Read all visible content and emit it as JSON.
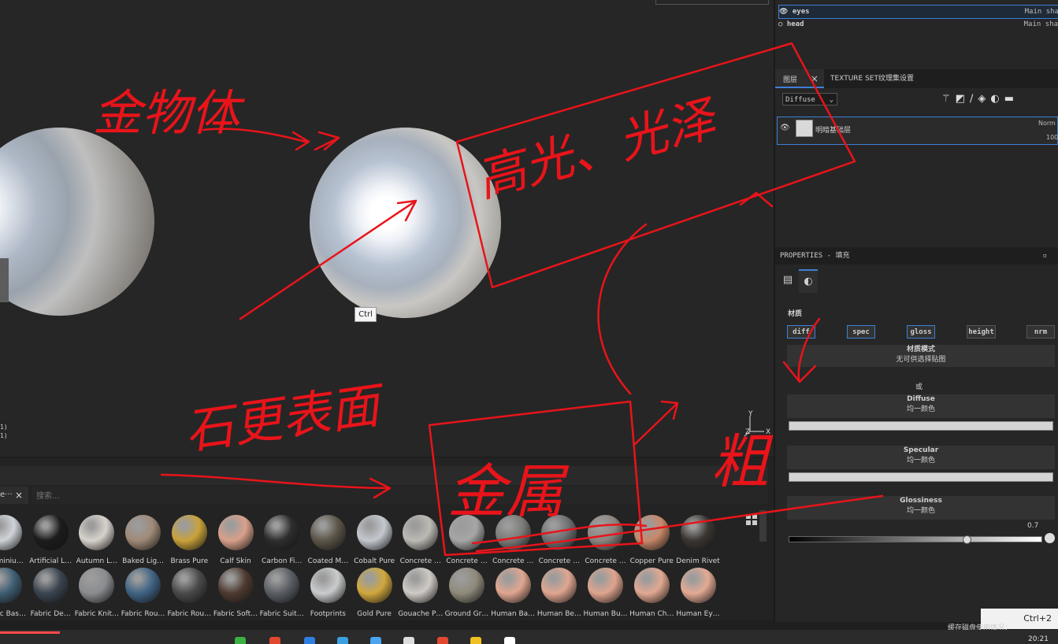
{
  "viewport": {
    "tooltip": "Ctrl",
    "coords_1": "1)",
    "coords_2": "1)",
    "axis_y": "Y",
    "axis_x": "X",
    "axis_z": "Z"
  },
  "shelf": {
    "tab_label": "e···",
    "close": "×",
    "search_placeholder": "搜索...",
    "materials": [
      {
        "label": "Aluminiu…",
        "color": "#cfd3d8"
      },
      {
        "label": "Artificial L…",
        "color": "#1c1c1c"
      },
      {
        "label": "Autumn L…",
        "color": "#d8d2cc"
      },
      {
        "label": "Baked Lig…",
        "color": "#a08a78"
      },
      {
        "label": "Brass Pure",
        "color": "#c9a23a"
      },
      {
        "label": "Calf Skin",
        "color": "#d9a08a"
      },
      {
        "label": "Carbon Fi…",
        "color": "#2e2e2e"
      },
      {
        "label": "Coated M…",
        "color": "#5c5548"
      },
      {
        "label": "Cobalt Pure",
        "color": "#c4c8cf"
      },
      {
        "label": "Concrete …",
        "color": "#bdbab4"
      },
      {
        "label": "Concrete …",
        "color": "#a6a6a6"
      },
      {
        "label": "Concrete …",
        "color": "#7a7a78"
      },
      {
        "label": "Concrete …",
        "color": "#6f6f72"
      },
      {
        "label": "Concrete …",
        "color": "#8c8580"
      },
      {
        "label": "Copper Pure",
        "color": "#c8886a"
      },
      {
        "label": "Denim Rivet",
        "color": "#3a3632"
      },
      {
        "label": "Fabric Bas…",
        "color": "#3f5f74"
      },
      {
        "label": "Fabric De…",
        "color": "#3a4450"
      },
      {
        "label": "Fabric Knit…",
        "color": "#8a8c90"
      },
      {
        "label": "Fabric Rou…",
        "color": "#3f6384"
      },
      {
        "label": "Fabric Rou…",
        "color": "#4a4a4a"
      },
      {
        "label": "Fabric Soft…",
        "color": "#4e3a30"
      },
      {
        "label": "Fabric Suit…",
        "color": "#5a5e64"
      },
      {
        "label": "Footprints",
        "color": "#c9cbcd"
      },
      {
        "label": "Gold Pure",
        "color": "#d1a83e"
      },
      {
        "label": "Gouache P…",
        "color": "#cfcac5"
      },
      {
        "label": "Ground Gr…",
        "color": "#8f8a7a"
      },
      {
        "label": "Human Ba…",
        "color": "#e0a690"
      },
      {
        "label": "Human Be…",
        "color": "#e0a690"
      },
      {
        "label": "Human Bu…",
        "color": "#dfa48e"
      },
      {
        "label": "Human Ch…",
        "color": "#e2a892"
      },
      {
        "label": "Human Ey…",
        "color": "#e3aa94"
      }
    ]
  },
  "tree": {
    "rows": [
      {
        "name": "eyes",
        "shader": "Main sha"
      },
      {
        "name": "head",
        "shader": "Main sha"
      }
    ]
  },
  "layers": {
    "tab_layers": "图层",
    "tab_close": "×",
    "tab_texset": "TEXTURE SET纹理集设置",
    "channel": "Diffuse",
    "layer_name": "明暗基础层",
    "blend": "Norm",
    "opacity": "100"
  },
  "properties": {
    "header": "PROPERTIES - 填充",
    "material_title": "材质",
    "channels": [
      "diff",
      "spec",
      "gloss",
      "height",
      "nrm"
    ],
    "mode_title": "材质模式",
    "mode_sub": "无可供选择贴图",
    "or_label": "或",
    "diffuse_title": "Diffuse",
    "diffuse_sub": "均一颜色",
    "specular_title": "Specular",
    "specular_sub": "均一颜色",
    "glossiness_title": "Glossiness",
    "glossiness_sub": "均一颜色",
    "glossiness_value": "0.7",
    "glossiness_level": 0.7
  },
  "status": {
    "toast": "Ctrl+2",
    "cache": "缓存磁盘使用情况：",
    "clock": "20:21"
  },
  "annotations": {
    "text_1": "金物体",
    "text_2": "高光、光泽",
    "text_3": "石更表面",
    "text_4": "金属",
    "text_5": "粗"
  },
  "colors": {
    "accent": "#3f7fd6",
    "annotation": "#e8141a"
  }
}
